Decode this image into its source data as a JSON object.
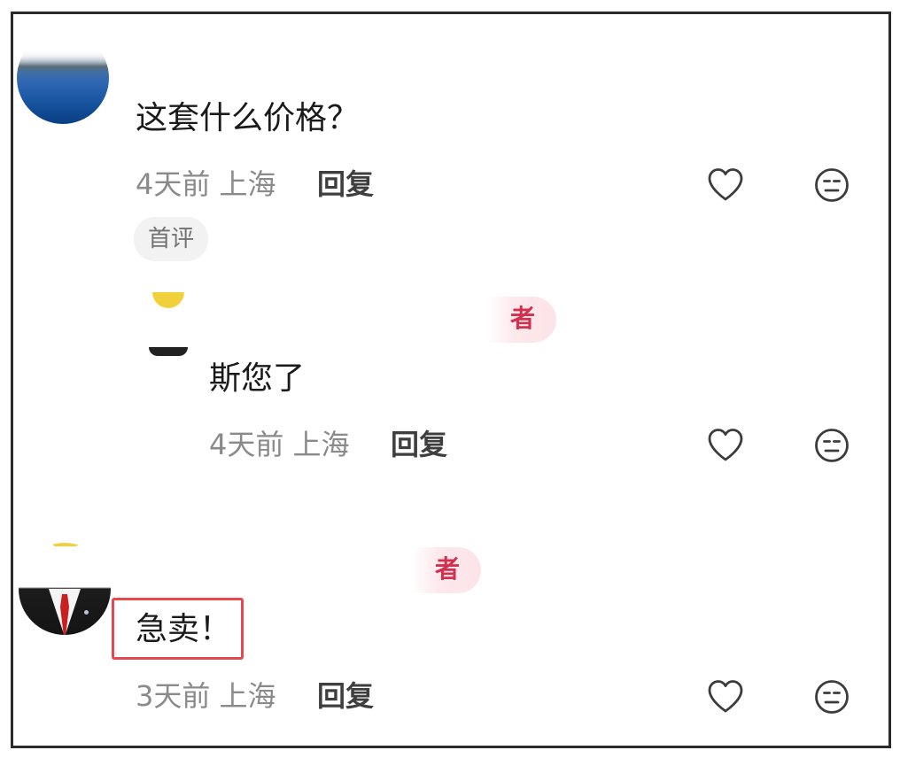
{
  "comments": [
    {
      "text": "这套什么价格？",
      "time": "4天前",
      "location": "上海",
      "reply_label": "回复",
      "tag": "首评",
      "avatar_icon": "sea-landscape-avatar"
    },
    {
      "badge_char": "者",
      "text": "斯您了",
      "time": "4天前",
      "location": "上海",
      "reply_label": "回复",
      "avatar_icon": "cartoon-avatar"
    },
    {
      "badge_char": "者",
      "text": "急卖！",
      "time": "3天前",
      "location": "上海",
      "reply_label": "回复",
      "avatar_icon": "suit-avatar"
    }
  ],
  "colors": {
    "highlight": "#e5484d",
    "badge_text": "#d33050",
    "meta_text": "#8a8a8a"
  },
  "icons": {
    "like": "heart-icon",
    "dislike": "neutral-face-icon"
  }
}
